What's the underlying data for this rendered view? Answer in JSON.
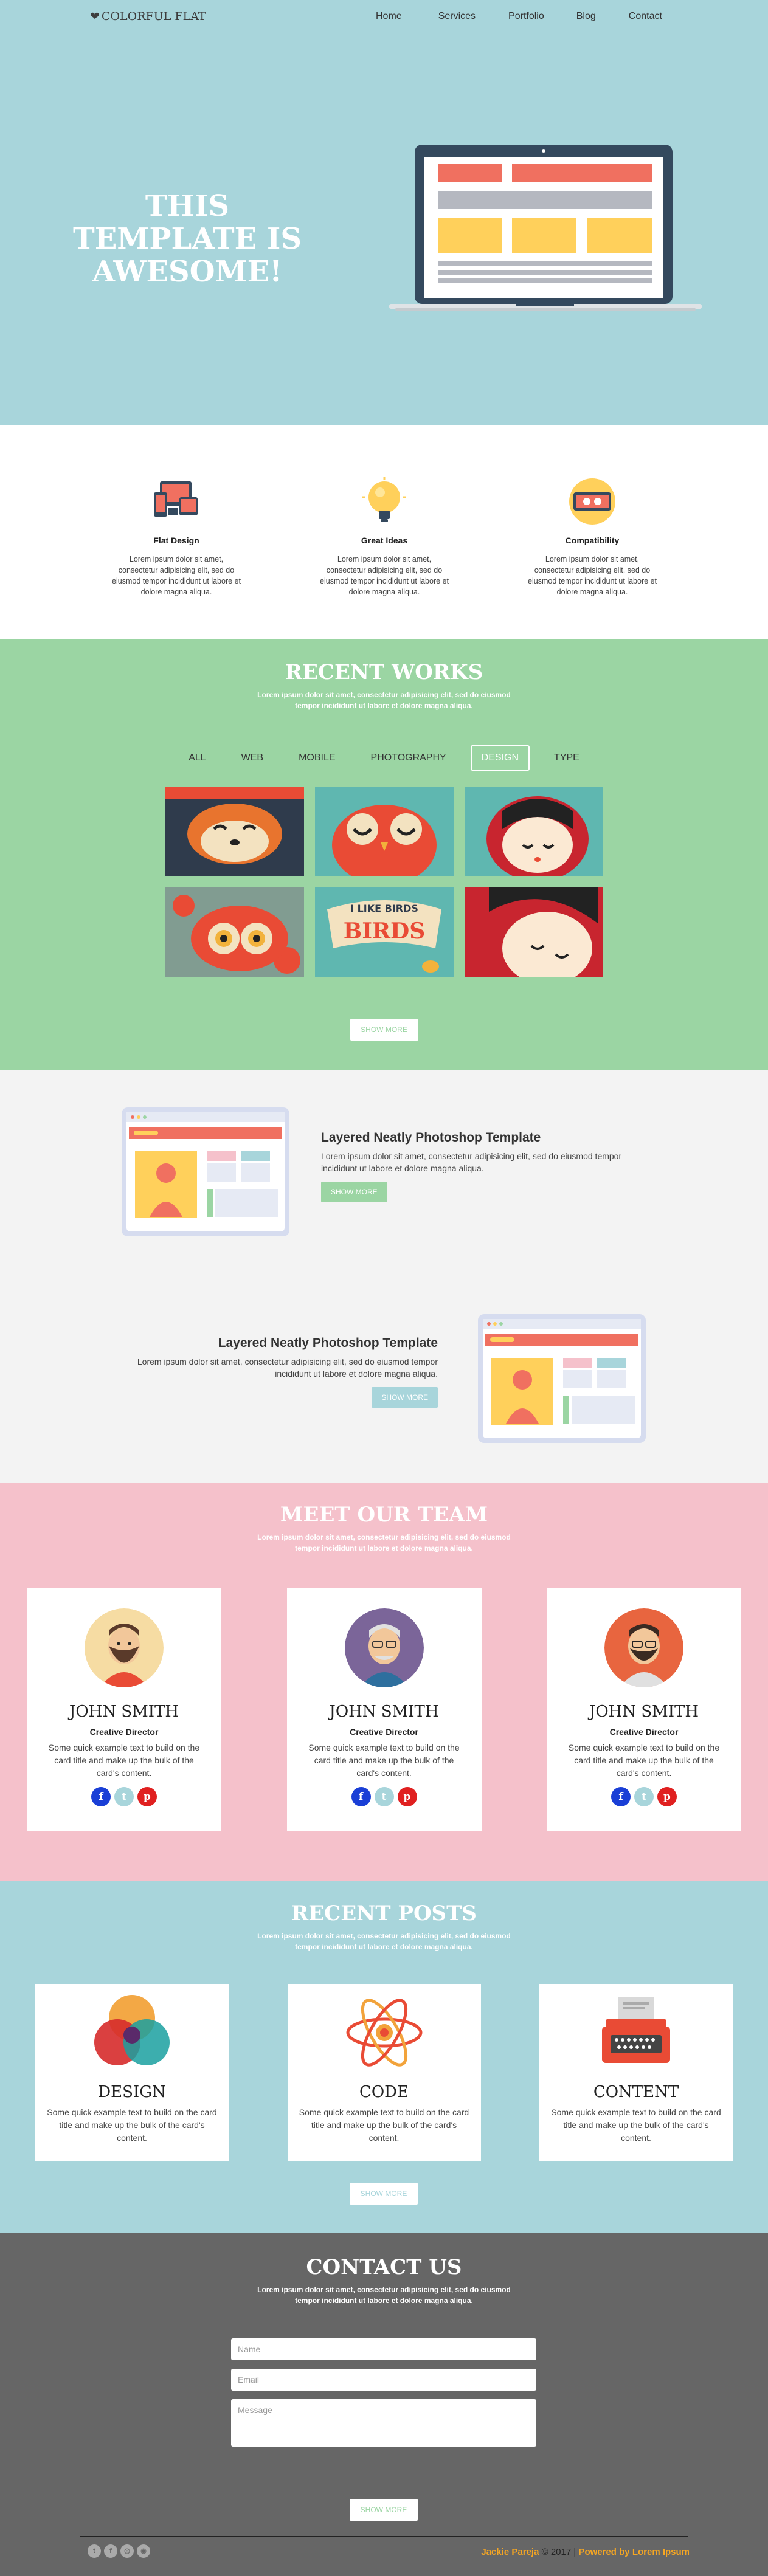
{
  "nav": {
    "brand": "COLORFUL FLAT",
    "heart": "❤",
    "links": [
      "Home",
      "Services",
      "Portfolio",
      "Blog",
      "Contact"
    ]
  },
  "hero": {
    "title": "THIS TEMPLATE IS AWESOME!"
  },
  "features": [
    {
      "icon": "devices-icon",
      "title": "Flat Design",
      "text": "Lorem ipsum dolor sit amet, consectetur adipisicing elit, sed do eiusmod tempor incididunt ut labore et dolore magna aliqua."
    },
    {
      "icon": "lightbulb-icon",
      "title": "Great Ideas",
      "text": "Lorem ipsum dolor sit amet, consectetur adipisicing elit, sed do eiusmod tempor incididunt ut labore et dolore magna aliqua."
    },
    {
      "icon": "compatibility-icon",
      "title": "Compatibility",
      "text": "Lorem ipsum dolor sit amet, consectetur adipisicing elit, sed do eiusmod tempor incididunt ut labore et dolore magna aliqua."
    }
  ],
  "works": {
    "title": "RECENT WORKS",
    "subtitle": "Lorem ipsum dolor sit amet, consectetur adipisicing elit, sed do eiusmod tempor incididunt ut labore et dolore magna aliqua.",
    "filters": [
      "ALL",
      "WEB",
      "MOBILE",
      "PHOTOGRAPHY",
      "DESIGN",
      "TYPE"
    ],
    "active_filter": "DESIGN",
    "birds_text": "I LIKE BIRDS",
    "button": "SHOW MORE"
  },
  "promo": [
    {
      "title": "Layered Neatly Photoshop Template",
      "text": "Lorem ipsum dolor sit amet, consectetur adipisicing elit, sed do eiusmod tempor incididunt ut labore et dolore magna aliqua.",
      "button": "SHOW MORE",
      "color": "#9bd5a3"
    },
    {
      "title": "Layered Neatly Photoshop Template",
      "text": "Lorem ipsum dolor sit amet, consectetur adipisicing elit, sed do eiusmod tempor incididunt ut labore et dolore magna aliqua.",
      "button": "SHOW MORE",
      "color": "#a8d5db"
    }
  ],
  "team": {
    "title": "MEET OUR TEAM",
    "subtitle": "Lorem ipsum dolor sit amet, consectetur adipisicing elit, sed do eiusmod tempor incididunt ut labore et dolore magna aliqua.",
    "members": [
      {
        "name": "JOHN SMITH",
        "role": "Creative Director",
        "bio": "Some quick example text to build on the card title and make up the bulk of the card's content."
      },
      {
        "name": "JOHN SMITH",
        "role": "Creative Director",
        "bio": "Some quick example text to build on the card title and make up the bulk of the card's content."
      },
      {
        "name": "JOHN SMITH",
        "role": "Creative Director",
        "bio": "Some quick example text to build on the card title and make up the bulk of the card's content."
      }
    ],
    "social": [
      "f",
      "t",
      "p"
    ]
  },
  "posts": {
    "title": "RECENT POSTS",
    "subtitle": "Lorem ipsum dolor sit amet, consectetur adipisicing elit, sed do eiusmod tempor incididunt ut labore et dolore magna aliqua.",
    "items": [
      {
        "icon": "color-circles-icon",
        "title": "DESIGN",
        "text": "Some quick example text to build on the card title and make up the bulk of the card's content."
      },
      {
        "icon": "atom-icon",
        "title": "CODE",
        "text": "Some quick example text to build on the card title and make up the bulk of the card's content."
      },
      {
        "icon": "typewriter-icon",
        "title": "CONTENT",
        "text": "Some quick example text to build on the card title and make up the bulk of the card's content."
      }
    ],
    "button": "SHOW MORE"
  },
  "contact": {
    "title": "CONTACT US",
    "subtitle": "Lorem ipsum dolor sit amet, consectetur adipisicing elit, sed do eiusmod tempor incididunt ut labore et dolore magna aliqua.",
    "name_placeholder": "Name",
    "email_placeholder": "Email",
    "message_placeholder": "Message",
    "button": "SHOW MORE"
  },
  "footer": {
    "author": "Jackie Pareja",
    "copyright": "© 2017 |",
    "powered": "Powered by Lorem Ipsum"
  }
}
